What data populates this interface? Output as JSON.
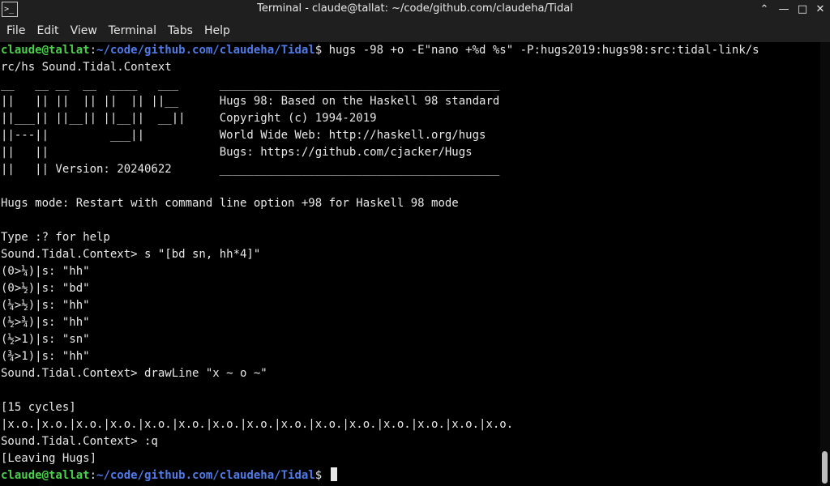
{
  "window": {
    "title": "Terminal - claude@tallat: ~/code/github.com/claudeha/Tidal",
    "app_icon": "terminal-icon",
    "controls": [
      "chevron-up-icon",
      "minimize-icon",
      "maximize-icon",
      "close-icon"
    ]
  },
  "menu": {
    "items": [
      "File",
      "Edit",
      "View",
      "Terminal",
      "Tabs",
      "Help"
    ]
  },
  "prompt": {
    "user": "claude@tallat",
    "sep": ":",
    "path": "~/code/github.com/claudeha/Tidal",
    "dollar": "$ "
  },
  "terminal": {
    "command_line1": "hugs -98 +o -E\"nano +%d %s\" -P:hugs2019:hugs98:src:tidal-link/s",
    "command_line2": "rc/hs Sound.Tidal.Context",
    "banner": [
      "__   __ __  __  ____   ___      _________________________________________",
      "||   || ||  || ||  || ||__      Hugs 98: Based on the Haskell 98 standard",
      "||___|| ||__|| ||__||  __||     Copyright (c) 1994-2019",
      "||---||         ___||           World Wide Web: http://haskell.org/hugs",
      "||   ||                         Bugs: https://github.com/cjacker/Hugs",
      "||   || Version: 20240622       _________________________________________"
    ],
    "mode_msg": "Hugs mode: Restart with command line option +98 for Haskell 98 mode",
    "help_msg": "Type :? for help",
    "session": [
      "Sound.Tidal.Context> s \"[bd sn, hh*4]\"",
      "(0>¼)|s: \"hh\"",
      "(0>½)|s: \"bd\"",
      "(¼>½)|s: \"hh\"",
      "(½>¾)|s: \"hh\"",
      "(½>1)|s: \"sn\"",
      "(¾>1)|s: \"hh\"",
      "Sound.Tidal.Context> drawLine \"x ~ o ~\"",
      "",
      "[15 cycles]",
      "|x.o.|x.o.|x.o.|x.o.|x.o.|x.o.|x.o.|x.o.|x.o.|x.o.|x.o.|x.o.|x.o.|x.o.|x.o.",
      "Sound.Tidal.Context> :q",
      "[Leaving Hugs]"
    ]
  },
  "colors": {
    "prompt_user": "#4bd04b",
    "prompt_path": "#4f7be8",
    "text": "#e8e8e8",
    "background": "#000000"
  }
}
